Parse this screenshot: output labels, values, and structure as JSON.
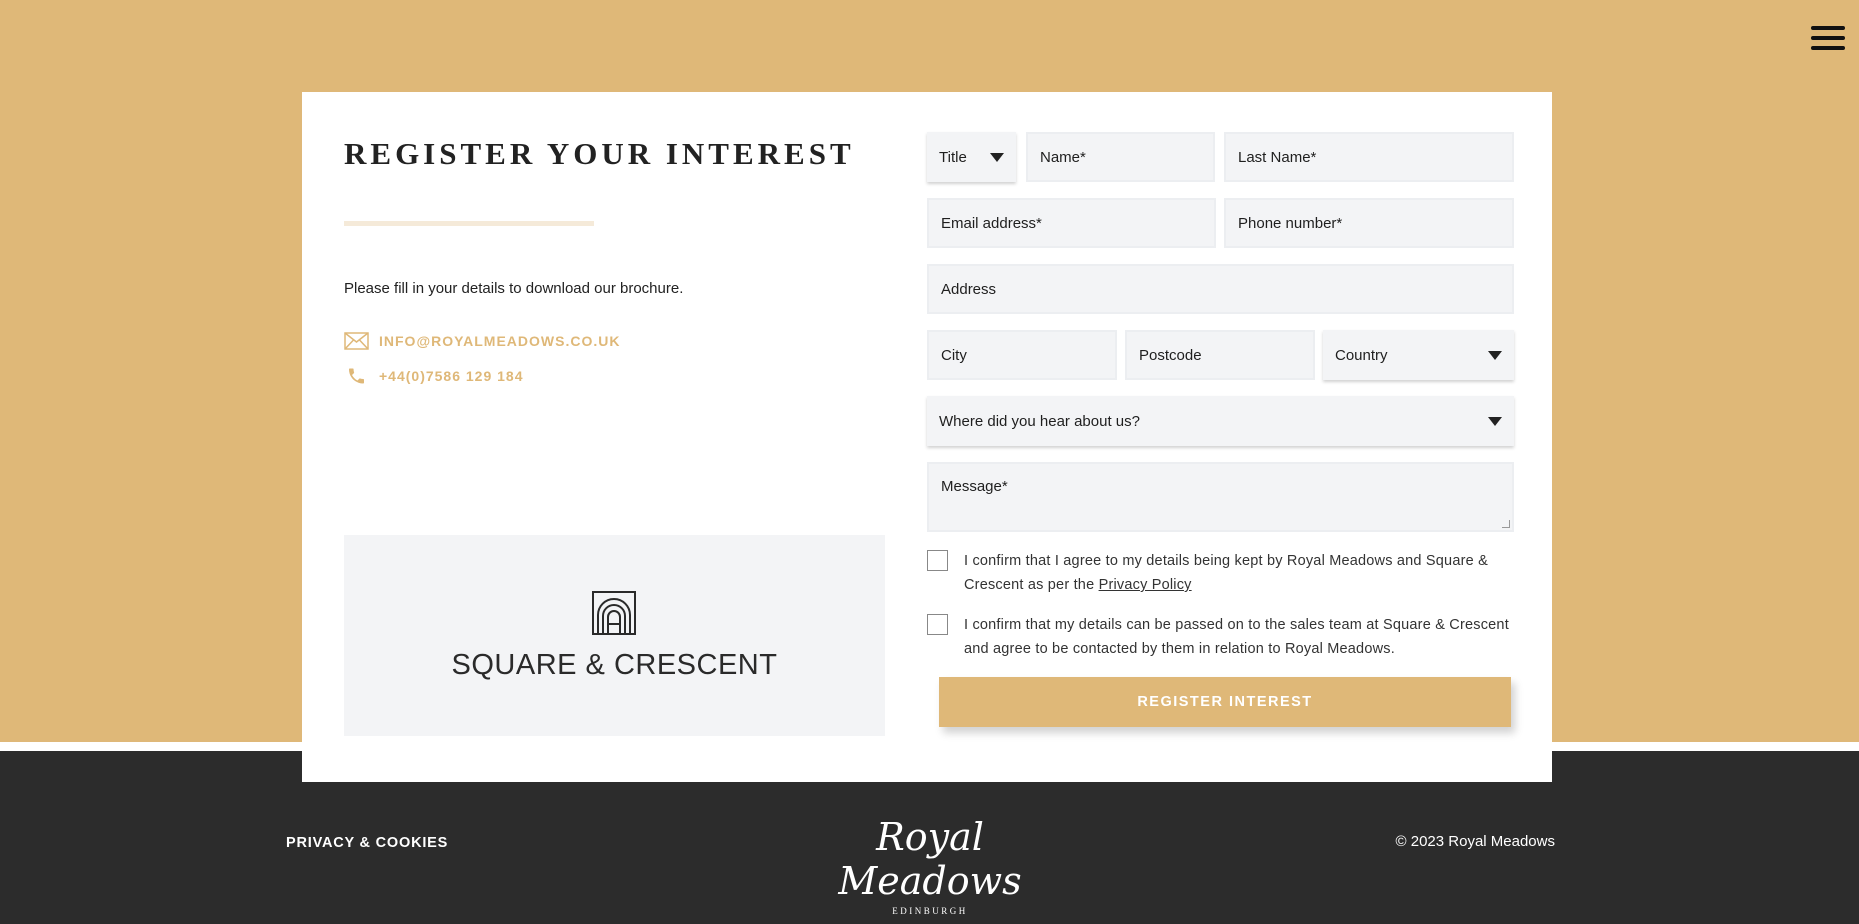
{
  "header": {
    "menu_icon": "hamburger-menu-icon"
  },
  "intro": {
    "heading": "REGISTER YOUR INTEREST",
    "description": "Please fill in your details to download our brochure.",
    "email": "INFO@ROYALMEADOWS.CO.UK",
    "phone": "+44(0)7586 129 184"
  },
  "partner": {
    "name": "SQUARE & CRESCENT"
  },
  "form": {
    "title_select": "Title",
    "name_placeholder": "Name*",
    "last_name_placeholder": "Last Name*",
    "email_placeholder": "Email address*",
    "phone_placeholder": "Phone number*",
    "address_placeholder": "Address",
    "city_placeholder": "City",
    "postcode_placeholder": "Postcode",
    "country_select": "Country",
    "source_select": "Where did you hear about us?",
    "message_placeholder": "Message*",
    "consent1_text": "I confirm that I agree to my details being kept by Royal Meadows and Square & Crescent as per the ",
    "consent1_link": "Privacy Policy",
    "consent2_text": "I confirm that my details can be passed on to the sales team at Square & Crescent and agree to be contacted by them in relation to Royal Meadows.",
    "submit_label": "REGISTER INTEREST"
  },
  "footer": {
    "privacy_link": "PRIVACY & COOKIES",
    "brand_script": "Royal Meadows",
    "brand_sub": "EDINBURGH",
    "copyright": "© 2023 Royal Meadows"
  },
  "colors": {
    "accent": "#dfb878",
    "footer_bg": "#2c2c2c",
    "field_bg": "#f3f4f6"
  }
}
